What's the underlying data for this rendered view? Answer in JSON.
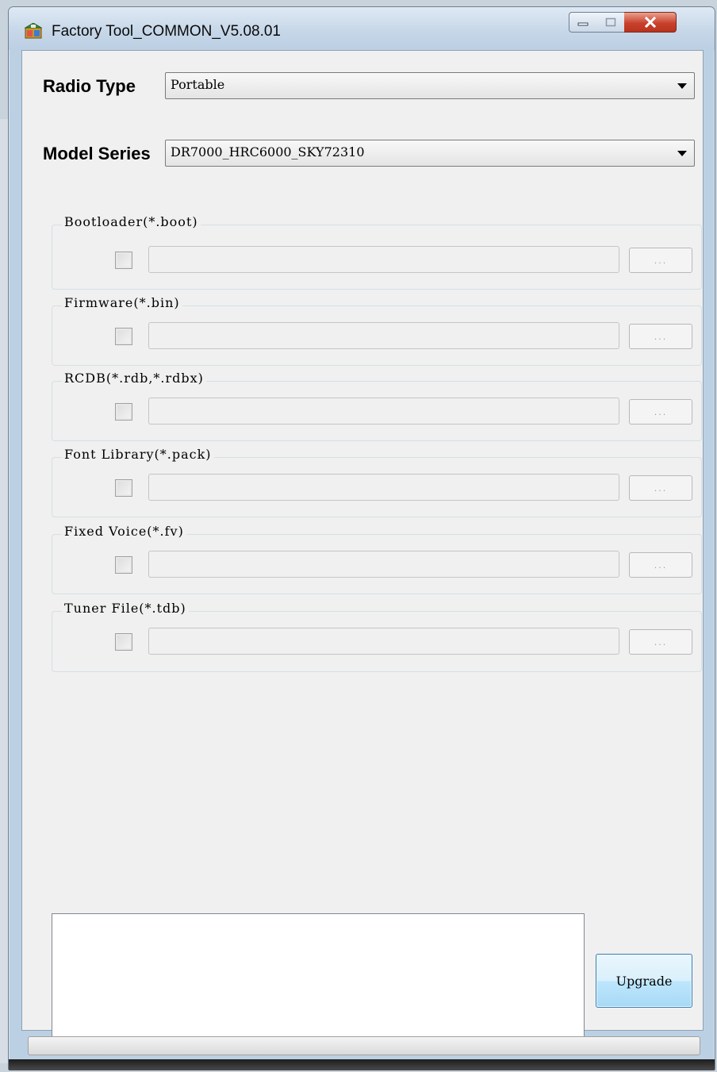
{
  "window": {
    "title": "Factory Tool_COMMON_V5.08.01",
    "icon": "factory-tool-app-icon"
  },
  "caption_buttons": {
    "minimize_icon": "minimize-icon",
    "maximize_icon": "maximize-icon",
    "close_icon": "close-icon"
  },
  "radio_type": {
    "label": "Radio Type",
    "selected": "Portable"
  },
  "model_series": {
    "label": "Model Series",
    "selected": "DR7000_HRC6000_SKY72310"
  },
  "file_groups": [
    {
      "title": "Bootloader(*.boot)",
      "checked": false,
      "path": "",
      "browse_label": "..."
    },
    {
      "title": "Firmware(*.bin)",
      "checked": false,
      "path": "",
      "browse_label": "..."
    },
    {
      "title": "RCDB(*.rdb,*.rdbx)",
      "checked": false,
      "path": "",
      "browse_label": "..."
    },
    {
      "title": "Font Library(*.pack)",
      "checked": false,
      "path": "",
      "browse_label": "..."
    },
    {
      "title": "Fixed Voice(*.fv)",
      "checked": false,
      "path": "",
      "browse_label": "..."
    },
    {
      "title": "Tuner File(*.tdb)",
      "checked": false,
      "path": "",
      "browse_label": "..."
    }
  ],
  "log": {
    "text": ""
  },
  "upgrade_button": {
    "label": "Upgrade"
  },
  "progress": {
    "value": 0
  },
  "colors": {
    "accent": "#3c7fb1",
    "close_red": "#c9412c",
    "client_bg": "#f0f0f0"
  }
}
